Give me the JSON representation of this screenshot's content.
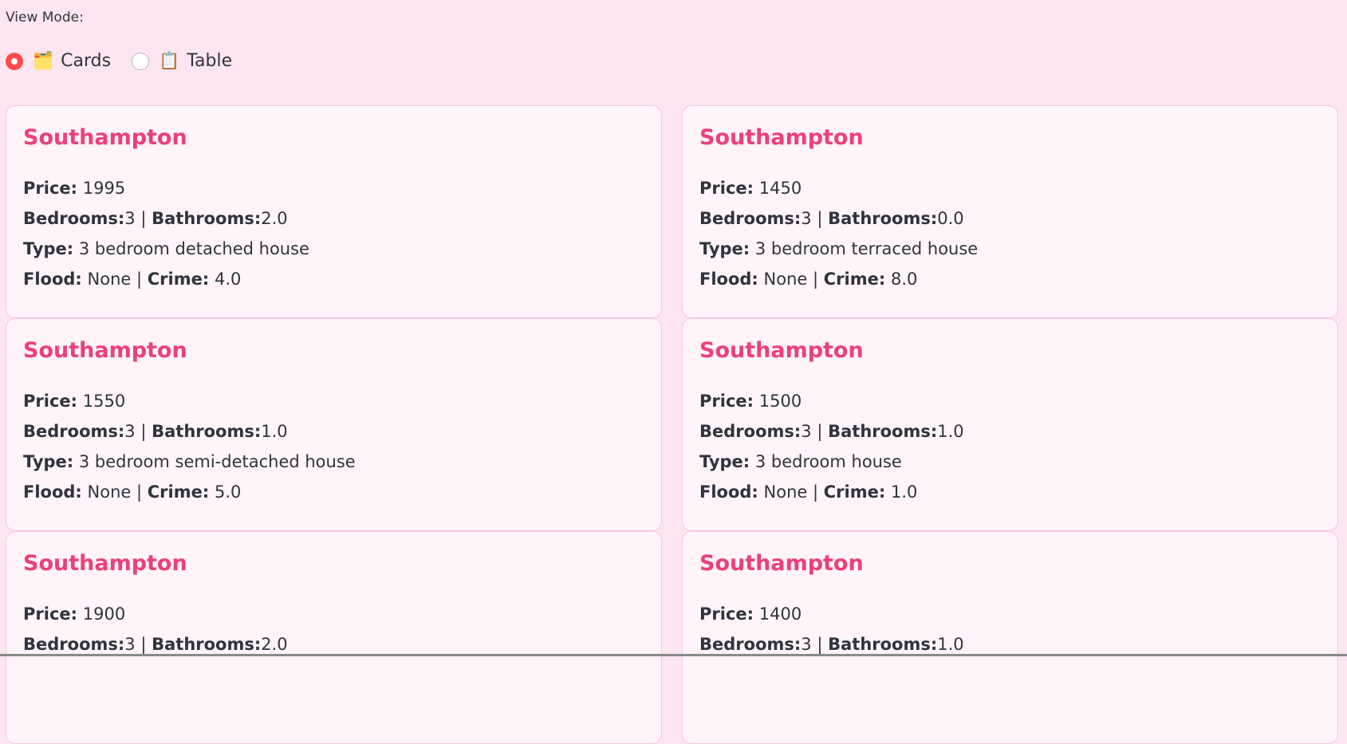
{
  "view_mode": {
    "label": "View Mode:",
    "options": [
      {
        "icon": "folder-icon",
        "glyph": "🗂️",
        "label": "Cards",
        "selected": true
      },
      {
        "icon": "clipboard-icon",
        "glyph": "📋",
        "label": "Table",
        "selected": false
      }
    ]
  },
  "field_labels": {
    "price": "Price:",
    "bedrooms": "Bedrooms:",
    "bathrooms": "Bathrooms:",
    "type": "Type:",
    "flood": "Flood:",
    "crime": "Crime:",
    "separator": "|"
  },
  "listings": [
    {
      "city": "Southampton",
      "price": "1995",
      "bedrooms": "3",
      "bathrooms": "2.0",
      "type": "3 bedroom detached house",
      "flood": "None",
      "crime": "4.0"
    },
    {
      "city": "Southampton",
      "price": "1450",
      "bedrooms": "3",
      "bathrooms": "0.0",
      "type": "3 bedroom terraced house",
      "flood": "None",
      "crime": "8.0"
    },
    {
      "city": "Southampton",
      "price": "1550",
      "bedrooms": "3",
      "bathrooms": "1.0",
      "type": "3 bedroom semi-detached house",
      "flood": "None",
      "crime": "5.0"
    },
    {
      "city": "Southampton",
      "price": "1500",
      "bedrooms": "3",
      "bathrooms": "1.0",
      "type": "3 bedroom house",
      "flood": "None",
      "crime": "1.0"
    },
    {
      "city": "Southampton",
      "price": "1900",
      "bedrooms": "3",
      "bathrooms": "2.0",
      "type": "",
      "flood": "",
      "crime": ""
    },
    {
      "city": "Southampton",
      "price": "1400",
      "bedrooms": "3",
      "bathrooms": "1.0",
      "type": "",
      "flood": "",
      "crime": ""
    }
  ],
  "colors": {
    "background": "#fde6f1",
    "card_background": "#fff4f9",
    "title": "#ec407a",
    "radio_selected": "#ff4b4b"
  }
}
